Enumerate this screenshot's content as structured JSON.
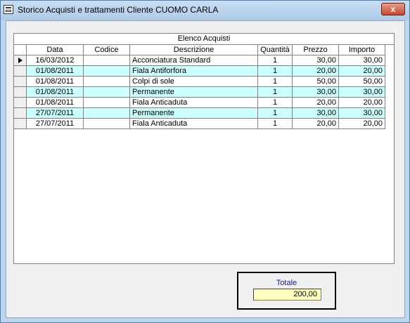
{
  "window": {
    "title": "Storico Acquisti e trattamenti Cliente CUOMO CARLA",
    "close_label": "x"
  },
  "grid": {
    "caption": "Elenco Acquisti",
    "columns": [
      "Data",
      "Codice",
      "Descrizione",
      "Quantità",
      "Prezzo",
      "Importo"
    ],
    "rows": [
      {
        "data": "16/03/2012",
        "codice": "",
        "descrizione": "Acconciatura Standard",
        "quantita": "1",
        "prezzo": "30,00",
        "importo": "30,00"
      },
      {
        "data": "01/08/2011",
        "codice": "",
        "descrizione": "Fiala Antiforfora",
        "quantita": "1",
        "prezzo": "20,00",
        "importo": "20,00"
      },
      {
        "data": "01/08/2011",
        "codice": "",
        "descrizione": "Colpi di sole",
        "quantita": "1",
        "prezzo": "50,00",
        "importo": "50,00"
      },
      {
        "data": "01/08/2011",
        "codice": "",
        "descrizione": "Permanente",
        "quantita": "1",
        "prezzo": "30,00",
        "importo": "30,00"
      },
      {
        "data": "01/08/2011",
        "codice": "",
        "descrizione": "Fiala Anticaduta",
        "quantita": "1",
        "prezzo": "20,00",
        "importo": "20,00"
      },
      {
        "data": "27/07/2011",
        "codice": "",
        "descrizione": "Permanente",
        "quantita": "1",
        "prezzo": "30,00",
        "importo": "30,00"
      },
      {
        "data": "27/07/2011",
        "codice": "",
        "descrizione": "Fiala Anticaduta",
        "quantita": "1",
        "prezzo": "20,00",
        "importo": "20,00"
      }
    ]
  },
  "totale": {
    "label": "Totale",
    "value": "200,00"
  },
  "colors": {
    "alt_row": "#ccffff",
    "total_field": "#ffffc0",
    "total_label": "#1a1a8c"
  }
}
